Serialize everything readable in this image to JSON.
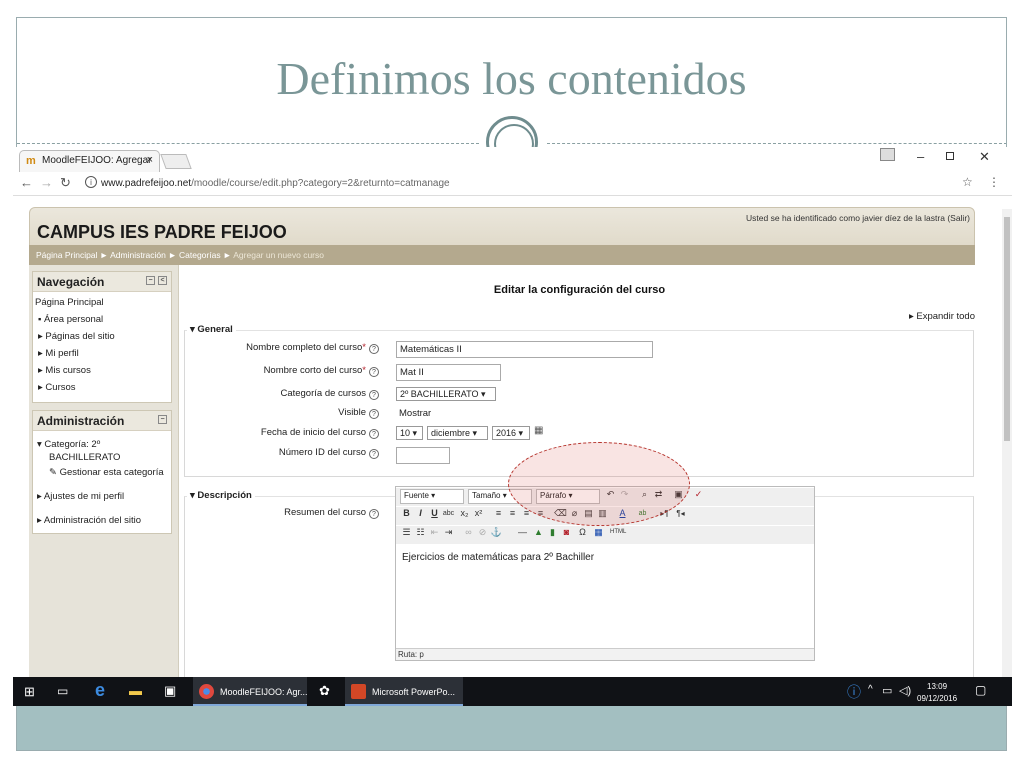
{
  "slide": {
    "title": "Definimos los contenidos"
  },
  "browser": {
    "tab_title": "MoodleFEIJOO: Agregar",
    "tab_close": "×",
    "url_host": "www.padrefeijoo.net",
    "url_path": "/moodle/course/edit.php?category=2&returnto=catmanage"
  },
  "site": {
    "title": "CAMPUS IES PADRE FEIJOO",
    "login_text": "Usted se ha identificado como javier díez de la lastra (Salir)",
    "breadcrumb": [
      "Página Principal",
      "Administración",
      "Categorías",
      "Agregar un nuevo curso"
    ]
  },
  "nav_block": {
    "title": "Navegación",
    "items": [
      "Página Principal",
      "Área personal",
      "Páginas del sitio",
      "Mi perfil",
      "Mis cursos",
      "Cursos"
    ]
  },
  "admin_block": {
    "title": "Administración",
    "category_line1": "Categoría: 2º",
    "category_line2": "BACHILLERATO",
    "manage": "Gestionar esta categoría",
    "profile": "Ajustes de mi perfil",
    "site_admin": "Administración del sitio"
  },
  "form": {
    "title": "Editar la configuración del curso",
    "expand": "Expandir todo",
    "general": "General",
    "fullname_label": "Nombre completo del curso",
    "fullname_value": "Matemáticas II",
    "shortname_label": "Nombre corto del curso",
    "shortname_value": "Mat II",
    "category_label": "Categoría de cursos",
    "category_value": "2º BACHILLERATO",
    "visible_label": "Visible",
    "visible_value": "Mostrar",
    "startdate_label": "Fecha de inicio del curso",
    "start_day": "10",
    "start_month": "diciembre",
    "start_year": "2016",
    "idnumber_label": "Número ID del curso",
    "description": "Descripción",
    "summary_label": "Resumen del curso",
    "font": "Fuente",
    "size": "Tamaño",
    "paragraph": "Párrafo",
    "summary_text": "Ejercicios de matemáticas para 2º Bachiller",
    "path": "Ruta: p"
  },
  "taskbar": {
    "app1": "MoodleFEIJOO: Agr...",
    "app2": "Microsoft PowerPo...",
    "time": "13:09",
    "date": "09/12/2016"
  }
}
